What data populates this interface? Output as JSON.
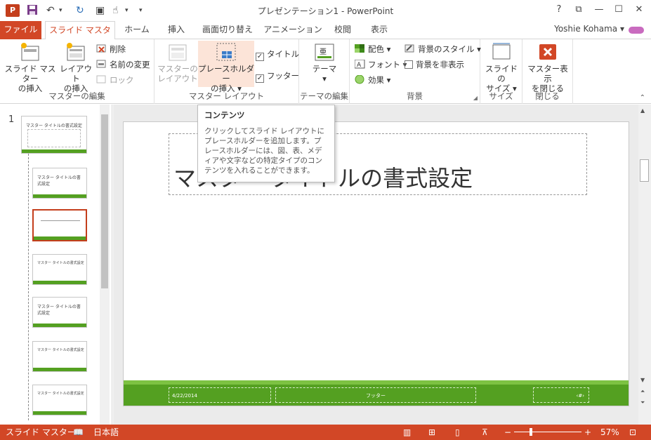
{
  "window": {
    "title": "プレゼンテーション1 - PowerPoint",
    "app_logo": "P",
    "help": "?",
    "controls": {
      "restore_ribbon": "⧉",
      "minimize": "—",
      "maximize": "☐",
      "close": "✕"
    }
  },
  "tabs": [
    "ファイル",
    "スライド マスター",
    "ホーム",
    "挿入",
    "画面切り替え",
    "アニメーション",
    "校閲",
    "表示"
  ],
  "user": {
    "name": "Yoshie Kohama ▾"
  },
  "ribbon": {
    "edit_master": {
      "label": "マスターの編集",
      "insert_master": "スライド マスター\nの挿入",
      "insert_layout": "レイアウト\nの挿入",
      "delete": "削除",
      "rename": "名前の変更",
      "lock": "ロック"
    },
    "master_layout": {
      "label": "マスター レイアウト",
      "master_layout_btn": "マスターの\nレイアウト",
      "insert_placeholder": "プレースホルダー\nの挿入 ▾",
      "title_check": "タイトル",
      "footer_check": "フッター"
    },
    "edit_theme": {
      "label": "テーマの編集",
      "themes": "テーマ\n▾"
    },
    "background": {
      "label": "背景",
      "colors": "配色 ▾",
      "fonts": "フォント ▾",
      "effects": "効果 ▾",
      "bg_styles": "背景のスタイル ▾",
      "hide_bg": "背景を非表示"
    },
    "size": {
      "label": "サイズ",
      "slide_size": "スライドの\nサイズ ▾"
    },
    "close": {
      "label": "閉じる",
      "close_master": "マスター表示\nを閉じる"
    }
  },
  "thumbnails": {
    "number": "1",
    "master_title": "マスター タイトルの書式設定",
    "layout_title": "マスター タイトルの書式設定"
  },
  "tooltip": {
    "title": "コンテンツ",
    "body": "クリックしてスライド レイアウトにプレースホルダーを追加します。プレースホルダーには、図、表、メディアや文字などの特定タイプのコンテンツを入れることができます。"
  },
  "slide": {
    "title": "マスター タイトルの書式設定",
    "footer_date": "4/22/2014",
    "footer_text": "フッター",
    "footer_num": "‹#›"
  },
  "status": {
    "view": "スライド マスター",
    "language": "日本語",
    "zoom_minus": "−",
    "zoom_plus": "+",
    "zoom": "57%"
  },
  "colors": {
    "accent": "#d24726",
    "green": "#54a021"
  }
}
